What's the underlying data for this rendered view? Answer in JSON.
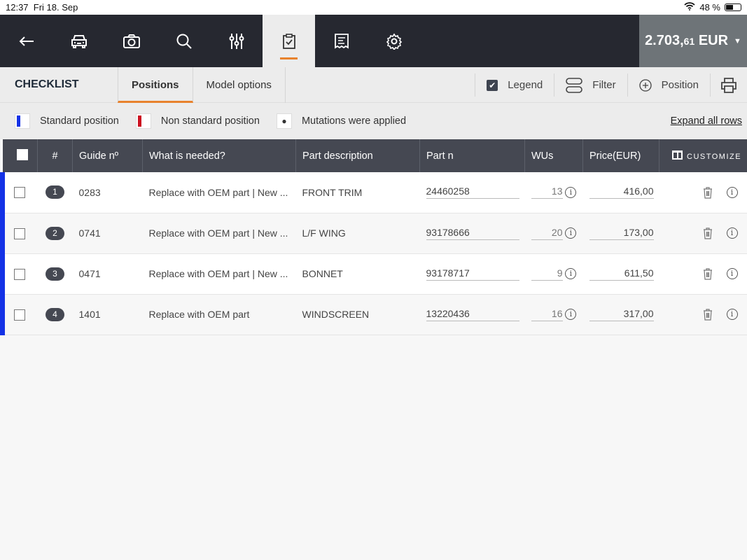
{
  "status": {
    "time": "12:37",
    "date": "Fri 18. Sep",
    "battery": "48 %",
    "battery_level": 0.48
  },
  "nav": {
    "items": [
      "back",
      "vehicle",
      "camera",
      "search",
      "adjustments",
      "checklist",
      "receipt",
      "settings"
    ],
    "active": "checklist"
  },
  "price": {
    "main": "2.703,",
    "cents": "61",
    "currency": "EUR"
  },
  "toolbar": {
    "title": "CHECKLIST",
    "tabs": [
      {
        "label": "Positions",
        "active": true
      },
      {
        "label": "Model options",
        "active": false
      }
    ],
    "legend_label": "Legend",
    "legend_checked": true,
    "filter_label": "Filter",
    "position_label": "Position"
  },
  "legend": {
    "standard": "Standard position",
    "non_standard": "Non standard position",
    "mutations": "Mutations were applied",
    "expand": "Expand all rows",
    "colors": {
      "standard": "#1432e6",
      "non_standard": "#cc1020"
    }
  },
  "table": {
    "headers": [
      "#",
      "Guide nº",
      "What is needed?",
      "Part description",
      "Part n",
      "WUs",
      "Price(EUR)",
      "CUSTOMIZE"
    ],
    "rows": [
      {
        "n": "1",
        "guide": "0283",
        "need": "Replace with OEM part | New ...",
        "desc": "FRONT TRIM",
        "part": "24460258",
        "wu": "13",
        "price": "416,00"
      },
      {
        "n": "2",
        "guide": "0741",
        "need": "Replace with OEM part | New ...",
        "desc": "L/F WING",
        "part": "93178666",
        "wu": "20",
        "price": "173,00"
      },
      {
        "n": "3",
        "guide": "0471",
        "need": "Replace with OEM part | New ...",
        "desc": "BONNET",
        "part": "93178717",
        "wu": "9",
        "price": "611,50"
      },
      {
        "n": "4",
        "guide": "1401",
        "need": "Replace with OEM part",
        "desc": "WINDSCREEN",
        "part": "13220436",
        "wu": "16",
        "price": "317,00"
      }
    ]
  }
}
